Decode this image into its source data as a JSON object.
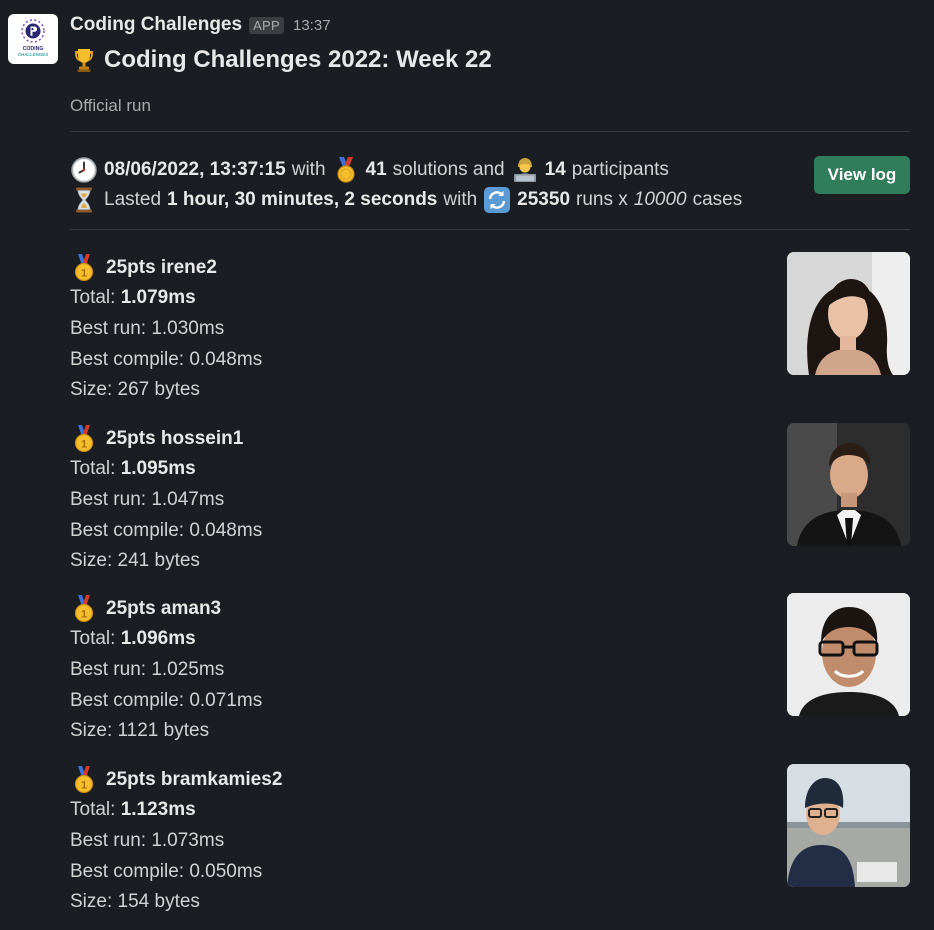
{
  "message": {
    "sender": "Coding Challenges",
    "badge": "APP",
    "time": "13:37",
    "app_logo_text": "CODING CHALLENGES",
    "title": "Coding Challenges 2022: Week 22",
    "subtitle": "Official run",
    "view_log_label": "View log"
  },
  "stats": {
    "datetime": "08/06/2022, 13:37:15",
    "with1": "with",
    "solutions_count": "41",
    "solutions_label": "solutions and",
    "participants_count": "14",
    "participants_label": "participants",
    "lasted_label": "Lasted",
    "duration": "1 hour, 30 minutes, 2 seconds",
    "with2": "with",
    "runs_count": "25350",
    "runs_label": "runs x",
    "cases_count": "10000",
    "cases_label": "cases"
  },
  "icons": {
    "trophy": "trophy-icon",
    "clock": "clock-icon",
    "medal": "sports-medal-icon",
    "participant": "technologist-icon",
    "hourglass": "hourglass-icon",
    "repeat": "repeat-icon",
    "first_place": "first-place-medal-icon"
  },
  "results": [
    {
      "header": "25pts irene2",
      "total_label": "Total:",
      "total": "1.079ms",
      "best_run": "Best run: 1.030ms",
      "best_compile": "Best compile: 0.048ms",
      "size": "Size: 267 bytes",
      "bg": "#cfcfcf"
    },
    {
      "header": "25pts hossein1",
      "total_label": "Total:",
      "total": "1.095ms",
      "best_run": "Best run: 1.047ms",
      "best_compile": "Best compile: 0.048ms",
      "size": "Size: 241 bytes",
      "bg": "#3a3a3a"
    },
    {
      "header": "25pts aman3",
      "total_label": "Total:",
      "total": "1.096ms",
      "best_run": "Best run: 1.025ms",
      "best_compile": "Best compile: 0.071ms",
      "size": "Size: 1121 bytes",
      "bg": "#e9e9e9"
    },
    {
      "header": "25pts bramkamies2",
      "total_label": "Total:",
      "total": "1.123ms",
      "best_run": "Best run: 1.073ms",
      "best_compile": "Best compile: 0.050ms",
      "size": "Size: 154 bytes",
      "bg": "#b9c2c9"
    }
  ],
  "colors": {
    "background": "#1a1d21",
    "button": "#2f7d5a",
    "text": "#d1d2d3",
    "muted": "#a9aaab"
  }
}
